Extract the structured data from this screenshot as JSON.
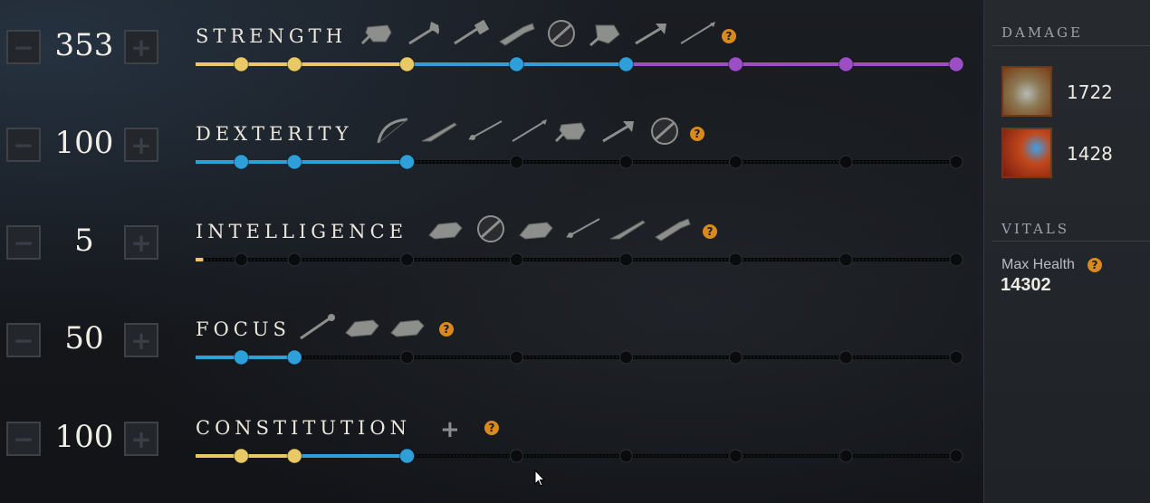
{
  "attributes": [
    {
      "name": "STRENGTH",
      "value": "353",
      "minus": "−",
      "plus": "+",
      "help": "?",
      "weapon_icons": [
        "shield-icon",
        "war-axe-icon",
        "war-hammer-icon",
        "blunderbuss-icon",
        "round-shield-icon",
        "great-axe-icon",
        "hatchet-icon",
        "spear-icon"
      ],
      "progress": {
        "fill_fraction": 1.0,
        "gold_dots": 3,
        "blue_dots": 2,
        "purple_dots": 3
      }
    },
    {
      "name": "DEXTERITY",
      "value": "100",
      "minus": "−",
      "plus": "+",
      "help": "?",
      "weapon_icons": [
        "bow-icon",
        "musket-icon",
        "rapier-icon",
        "spear-icon",
        "shield-icon",
        "hatchet-icon",
        "round-shield-icon"
      ],
      "progress": {
        "fill_fraction": 0.278,
        "gold_dots": 0,
        "blue_dots": 3,
        "purple_dots": 0
      }
    },
    {
      "name": "INTELLIGENCE",
      "value": "5",
      "minus": "−",
      "plus": "+",
      "help": "?",
      "weapon_icons": [
        "gauntlet-icon",
        "round-shield-icon",
        "gauntlet-icon",
        "rapier-icon",
        "musket-icon",
        "blunderbuss-icon"
      ],
      "progress": {
        "fill_fraction": 0.01,
        "gold_dots": 0,
        "blue_dots": 0,
        "purple_dots": 0
      }
    },
    {
      "name": "FOCUS",
      "value": "50",
      "minus": "−",
      "plus": "+",
      "help": "?",
      "weapon_icons": [
        "staff-icon",
        "gauntlet-icon",
        "gauntlet-icon"
      ],
      "progress": {
        "fill_fraction": 0.133,
        "gold_dots": 0,
        "blue_dots": 2,
        "purple_dots": 0
      }
    },
    {
      "name": "CONSTITUTION",
      "value": "100",
      "minus": "−",
      "plus": "+",
      "help": "?",
      "bonus_icon": "+",
      "weapon_icons": [],
      "progress": {
        "fill_fraction": 0.278,
        "gold_dots": 2,
        "blue_dots": 1,
        "purple_dots": 0
      }
    }
  ],
  "damage": {
    "heading": "DAMAGE",
    "items": [
      {
        "icon": "war-hammer-weapon-icon",
        "value": "1722"
      },
      {
        "icon": "fire-staff-weapon-icon",
        "value": "1428"
      }
    ]
  },
  "vitals": {
    "heading": "VITALS",
    "max_health_label": "Max Health",
    "help": "?",
    "max_health_value": "14302"
  },
  "colors": {
    "gold": "#e8c965",
    "blue": "#2e9fd8",
    "purple": "#9b4fc4",
    "inactive": "#0a0b0d",
    "help": "#d88a1c"
  }
}
